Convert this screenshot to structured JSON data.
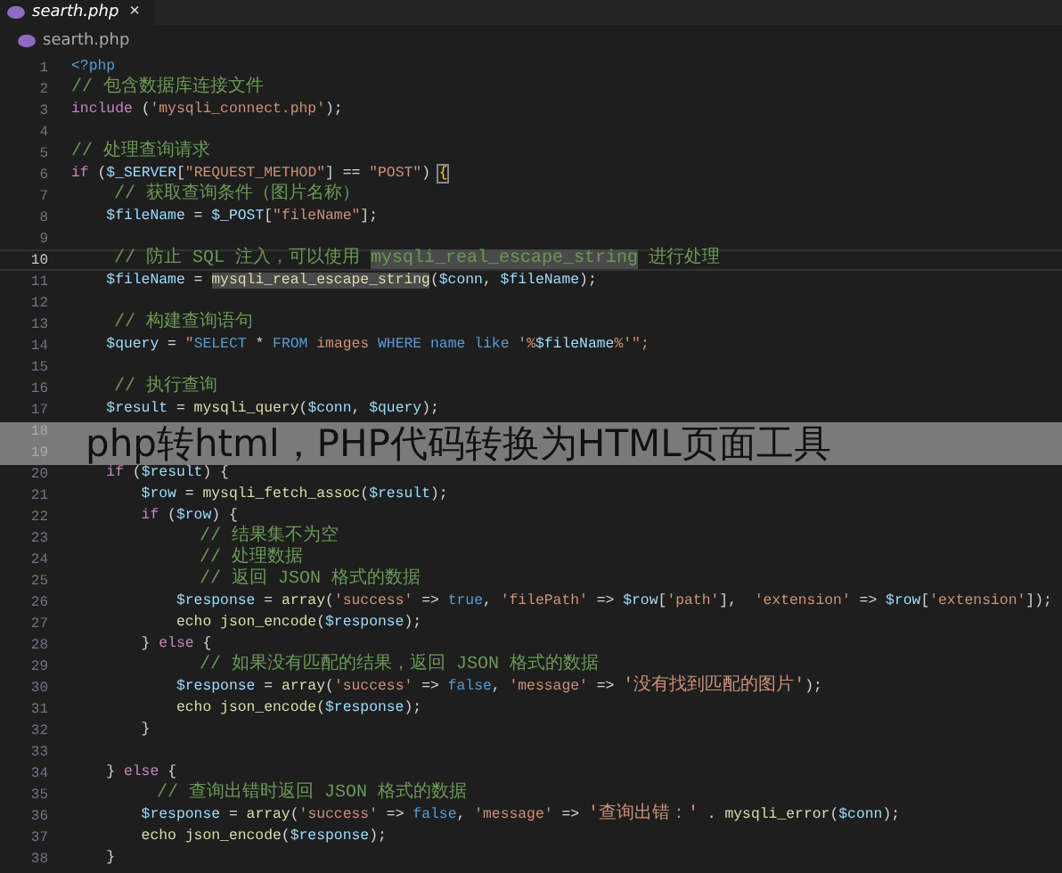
{
  "tab": {
    "title": "searth.php",
    "close": "×",
    "selected": true
  },
  "breadcrumb": "searth.php",
  "lines": [
    {
      "n": "1",
      "selected": false,
      "tokens": [
        {
          "t": "<?php",
          "kind": "kw2"
        }
      ]
    },
    {
      "n": "2",
      "selected": false,
      "tokens": [
        {
          "t": "// 包含数据库连接文件",
          "kind": "cm"
        }
      ]
    },
    {
      "n": "3",
      "selected": false,
      "tokens": [
        {
          "t": "include ",
          "kind": "kw"
        },
        {
          "t": "(",
          "kind": "p"
        },
        {
          "t": "'mysqli_connect.php'",
          "kind": "str"
        },
        {
          "t": ");",
          "kind": "p"
        }
      ]
    },
    {
      "n": "4",
      "selected": false
    },
    {
      "n": "5",
      "selected": false,
      "tokens": [
        {
          "t": "// 处理查询请求",
          "kind": "cm"
        }
      ]
    },
    {
      "n": "6",
      "selected": false,
      "tokens": [
        {
          "t": "if ",
          "kind": "kw"
        },
        {
          "t": "(",
          "kind": "p"
        },
        {
          "t": "$_SERVER",
          "kind": "var"
        },
        {
          "t": "[",
          "kind": "p"
        },
        {
          "t": "\"REQUEST_METHOD\"",
          "kind": "str"
        },
        {
          "t": "] == ",
          "kind": "p"
        },
        {
          "t": "\"POST\"",
          "kind": "str"
        },
        {
          "t": ") ",
          "kind": "p"
        },
        {
          "t": "{",
          "kind": "hl"
        }
      ]
    },
    {
      "n": "7",
      "selected": false,
      "tokens": [
        {
          "t": "    // 获取查询条件（图片名称）",
          "kind": "cm"
        }
      ]
    },
    {
      "n": "8",
      "selected": false,
      "tokens": [
        {
          "t": "    $fileName",
          "kind": "var"
        },
        {
          "t": " = ",
          "kind": "p"
        },
        {
          "t": "$_POST",
          "kind": "var"
        },
        {
          "t": "[",
          "kind": "p"
        },
        {
          "t": "\"fileName\"",
          "kind": "str"
        },
        {
          "t": "];",
          "kind": "p"
        }
      ]
    },
    {
      "n": "9",
      "selected": false
    },
    {
      "n": "10",
      "selected": true,
      "tokens": [
        {
          "t": "    // 防止 SQL 注入，可以使用 ",
          "kind": "cm"
        },
        {
          "t": "mysqli_real_escape_string",
          "kind": "cmhl"
        },
        {
          "t": " 进行处理",
          "kind": "cm"
        }
      ]
    },
    {
      "n": "11",
      "selected": false,
      "tokens": [
        {
          "t": "    $fileName",
          "kind": "var"
        },
        {
          "t": " = ",
          "kind": "p"
        },
        {
          "t": "mysqli_real_escape_string",
          "kind": "fnhl"
        },
        {
          "t": "(",
          "kind": "p"
        },
        {
          "t": "$conn",
          "kind": "var"
        },
        {
          "t": ", ",
          "kind": "p"
        },
        {
          "t": "$fileName",
          "kind": "var"
        },
        {
          "t": ");",
          "kind": "p"
        }
      ]
    },
    {
      "n": "12",
      "selected": false
    },
    {
      "n": "13",
      "selected": false,
      "tokens": [
        {
          "t": "    // 构建查询语句",
          "kind": "cm"
        }
      ]
    },
    {
      "n": "14",
      "selected": false,
      "tokens": [
        {
          "t": "    $query",
          "kind": "var"
        },
        {
          "t": " = ",
          "kind": "p"
        },
        {
          "t": "\"",
          "kind": "str"
        },
        {
          "t": "SELECT",
          "kind": "kw2"
        },
        {
          "t": " * ",
          "kind": "p"
        },
        {
          "t": "FROM",
          "kind": "kw2"
        },
        {
          "t": " images ",
          "kind": "str"
        },
        {
          "t": "WHERE",
          "kind": "kw2"
        },
        {
          "t": " name ",
          "kind": "kw2"
        },
        {
          "t": "like ",
          "kind": "kw2"
        },
        {
          "t": "'%",
          "kind": "str"
        },
        {
          "t": "$fileName",
          "kind": "var"
        },
        {
          "t": "%'\";",
          "kind": "str"
        }
      ]
    },
    {
      "n": "15",
      "selected": false
    },
    {
      "n": "16",
      "selected": false,
      "tokens": [
        {
          "t": "    // 执行查询",
          "kind": "cm"
        }
      ]
    },
    {
      "n": "17",
      "selected": false,
      "tokens": [
        {
          "t": "    $result",
          "kind": "var"
        },
        {
          "t": " = ",
          "kind": "p"
        },
        {
          "t": "mysqli_query",
          "kind": "fn"
        },
        {
          "t": "(",
          "kind": "p"
        },
        {
          "t": "$conn",
          "kind": "var"
        },
        {
          "t": ", ",
          "kind": "p"
        },
        {
          "t": "$query",
          "kind": "var"
        },
        {
          "t": ");",
          "kind": "p"
        }
      ]
    },
    {
      "n": "18",
      "selected": false
    },
    {
      "n": "19",
      "selected": false
    },
    {
      "n": "20",
      "selected": false,
      "tokens": [
        {
          "t": "    if ",
          "kind": "kw"
        },
        {
          "t": "(",
          "kind": "p"
        },
        {
          "t": "$result",
          "kind": "var"
        },
        {
          "t": ") {",
          "kind": "p"
        }
      ]
    },
    {
      "n": "21",
      "selected": false,
      "tokens": [
        {
          "t": "        $row",
          "kind": "var"
        },
        {
          "t": " = ",
          "kind": "p"
        },
        {
          "t": "mysqli_fetch_assoc",
          "kind": "fn"
        },
        {
          "t": "(",
          "kind": "p"
        },
        {
          "t": "$result",
          "kind": "var"
        },
        {
          "t": ");",
          "kind": "p"
        }
      ]
    },
    {
      "n": "22",
      "selected": false,
      "tokens": [
        {
          "t": "        if ",
          "kind": "kw"
        },
        {
          "t": "(",
          "kind": "p"
        },
        {
          "t": "$row",
          "kind": "var"
        },
        {
          "t": ") {",
          "kind": "p"
        }
      ]
    },
    {
      "n": "23",
      "selected": false,
      "tokens": [
        {
          "t": "            // 结果集不为空",
          "kind": "cm"
        }
      ]
    },
    {
      "n": "24",
      "selected": false,
      "tokens": [
        {
          "t": "            // 处理数据",
          "kind": "cm"
        }
      ]
    },
    {
      "n": "25",
      "selected": false,
      "tokens": [
        {
          "t": "            // 返回 JSON 格式的数据",
          "kind": "cm"
        }
      ]
    },
    {
      "n": "26",
      "selected": false,
      "tokens": [
        {
          "t": "            $response",
          "kind": "var"
        },
        {
          "t": " = ",
          "kind": "p"
        },
        {
          "t": "array",
          "kind": "fn"
        },
        {
          "t": "(",
          "kind": "p"
        },
        {
          "t": "'success'",
          "kind": "str"
        },
        {
          "t": " => ",
          "kind": "p"
        },
        {
          "t": "true",
          "kind": "kw2"
        },
        {
          "t": ", ",
          "kind": "p"
        },
        {
          "t": "'filePath'",
          "kind": "str"
        },
        {
          "t": " => ",
          "kind": "p"
        },
        {
          "t": "$row",
          "kind": "var"
        },
        {
          "t": "[",
          "kind": "p"
        },
        {
          "t": "'path'",
          "kind": "str"
        },
        {
          "t": "],  ",
          "kind": "p"
        },
        {
          "t": "'extension'",
          "kind": "str"
        },
        {
          "t": " => ",
          "kind": "p"
        },
        {
          "t": "$row",
          "kind": "var"
        },
        {
          "t": "[",
          "kind": "p"
        },
        {
          "t": "'extension'",
          "kind": "str"
        },
        {
          "t": "]);",
          "kind": "p"
        }
      ]
    },
    {
      "n": "27",
      "selected": false,
      "tokens": [
        {
          "t": "            echo json_encode",
          "kind": "fn"
        },
        {
          "t": "(",
          "kind": "p"
        },
        {
          "t": "$response",
          "kind": "var"
        },
        {
          "t": ");",
          "kind": "p"
        }
      ]
    },
    {
      "n": "28",
      "selected": false,
      "tokens": [
        {
          "t": "        } ",
          "kind": "p"
        },
        {
          "t": "else ",
          "kind": "kw"
        },
        {
          "t": "{",
          "kind": "p"
        }
      ]
    },
    {
      "n": "29",
      "selected": false,
      "tokens": [
        {
          "t": "            // 如果没有匹配的结果，返回 JSON 格式的数据",
          "kind": "cm"
        }
      ]
    },
    {
      "n": "30",
      "selected": false,
      "tokens": [
        {
          "t": "            $response",
          "kind": "var"
        },
        {
          "t": " = ",
          "kind": "p"
        },
        {
          "t": "array",
          "kind": "fn"
        },
        {
          "t": "(",
          "kind": "p"
        },
        {
          "t": "'success'",
          "kind": "str"
        },
        {
          "t": " => ",
          "kind": "p"
        },
        {
          "t": "false",
          "kind": "kw2"
        },
        {
          "t": ", ",
          "kind": "p"
        },
        {
          "t": "'message'",
          "kind": "str"
        },
        {
          "t": " => ",
          "kind": "p"
        },
        {
          "t": "'没有找到匹配的图片'",
          "kind": "strzh"
        },
        {
          "t": ");",
          "kind": "p"
        }
      ]
    },
    {
      "n": "31",
      "selected": false,
      "tokens": [
        {
          "t": "            echo json_encode",
          "kind": "fn"
        },
        {
          "t": "(",
          "kind": "p"
        },
        {
          "t": "$response",
          "kind": "var"
        },
        {
          "t": ");",
          "kind": "p"
        }
      ]
    },
    {
      "n": "32",
      "selected": false,
      "tokens": [
        {
          "t": "        }",
          "kind": "p"
        }
      ]
    },
    {
      "n": "33",
      "selected": false
    },
    {
      "n": "34",
      "selected": false,
      "tokens": [
        {
          "t": "    } ",
          "kind": "p"
        },
        {
          "t": "else ",
          "kind": "kw"
        },
        {
          "t": "{",
          "kind": "p"
        }
      ]
    },
    {
      "n": "35",
      "selected": false,
      "tokens": [
        {
          "t": "        // 查询出错时返回 JSON 格式的数据",
          "kind": "cm"
        }
      ]
    },
    {
      "n": "36",
      "selected": false,
      "tokens": [
        {
          "t": "        $response",
          "kind": "var"
        },
        {
          "t": " = ",
          "kind": "p"
        },
        {
          "t": "array",
          "kind": "fn"
        },
        {
          "t": "(",
          "kind": "p"
        },
        {
          "t": "'success'",
          "kind": "str"
        },
        {
          "t": " => ",
          "kind": "p"
        },
        {
          "t": "false",
          "kind": "kw2"
        },
        {
          "t": ", ",
          "kind": "p"
        },
        {
          "t": "'message'",
          "kind": "str"
        },
        {
          "t": " => ",
          "kind": "p"
        },
        {
          "t": "'查询出错：'",
          "kind": "strzh"
        },
        {
          "t": " . ",
          "kind": "p"
        },
        {
          "t": "mysqli_error",
          "kind": "fn"
        },
        {
          "t": "(",
          "kind": "p"
        },
        {
          "t": "$conn",
          "kind": "var"
        },
        {
          "t": ");",
          "kind": "p"
        }
      ]
    },
    {
      "n": "37",
      "selected": false,
      "tokens": [
        {
          "t": "        echo json_encode",
          "kind": "fn"
        },
        {
          "t": "(",
          "kind": "p"
        },
        {
          "t": "$response",
          "kind": "var"
        },
        {
          "t": ");",
          "kind": "p"
        }
      ]
    },
    {
      "n": "38",
      "selected": false,
      "tokens": [
        {
          "t": "    }",
          "kind": "p"
        }
      ]
    }
  ],
  "banner": "php转html，PHP代码转换为HTML页面工具"
}
